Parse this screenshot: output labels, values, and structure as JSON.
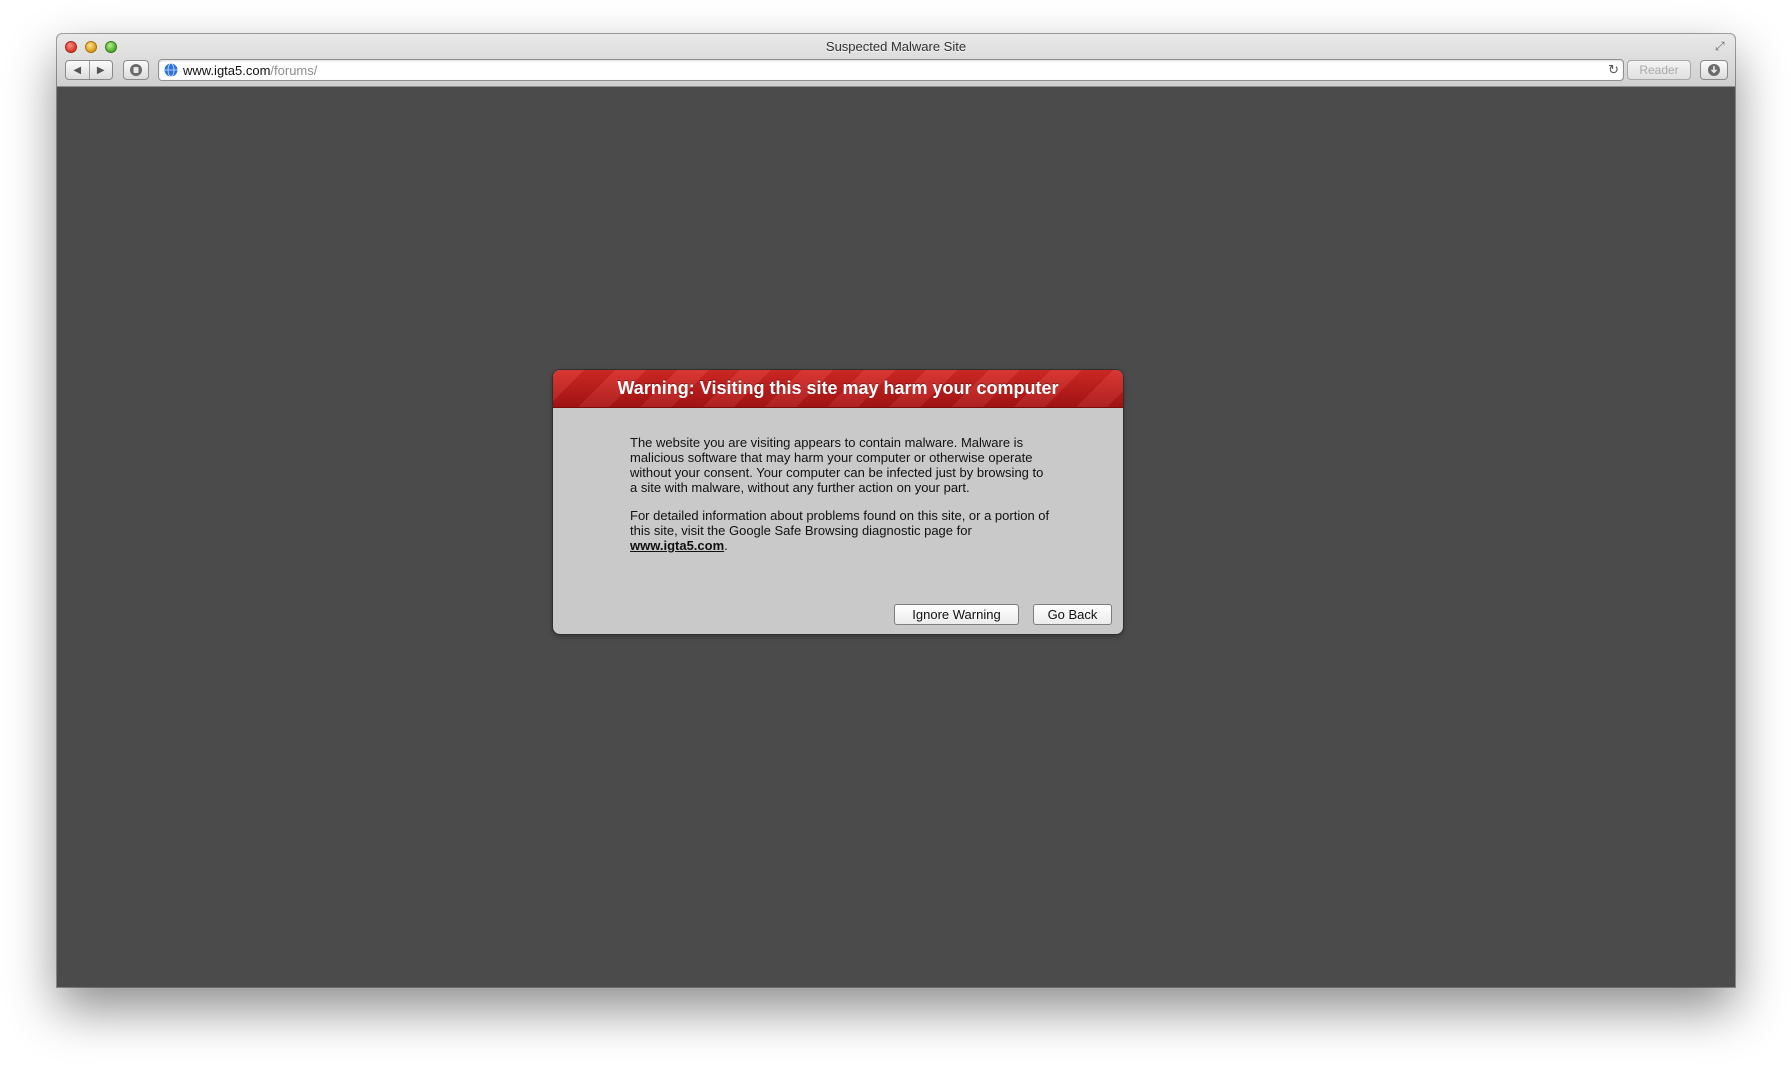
{
  "window": {
    "title": "Suspected Malware Site"
  },
  "toolbar": {
    "back_icon": "back-arrow-icon",
    "forward_icon": "forward-arrow-icon",
    "share_icon": "share-icon",
    "address": {
      "host": "www.igta5.com",
      "path": "/forums/"
    },
    "reload_icon": "reload-icon",
    "reader_label": "Reader",
    "downloads_icon": "downloads-icon"
  },
  "warning": {
    "title": "Warning: Visiting this site may harm your computer",
    "paragraph1": "The website you are visiting appears to contain malware. Malware is malicious software that may harm your computer or otherwise operate without your consent. Your computer can be infected just by browsing to a site with malware, without any further action on your part.",
    "paragraph2_prefix": "For detailed information about problems found on this site, or a portion of this site, visit the Google Safe Browsing diagnostic page for ",
    "paragraph2_link": "www.igta5.com",
    "paragraph2_suffix": ".",
    "ignore_label": "Ignore Warning",
    "back_label": "Go Back",
    "header_color": "#c41e1a"
  }
}
